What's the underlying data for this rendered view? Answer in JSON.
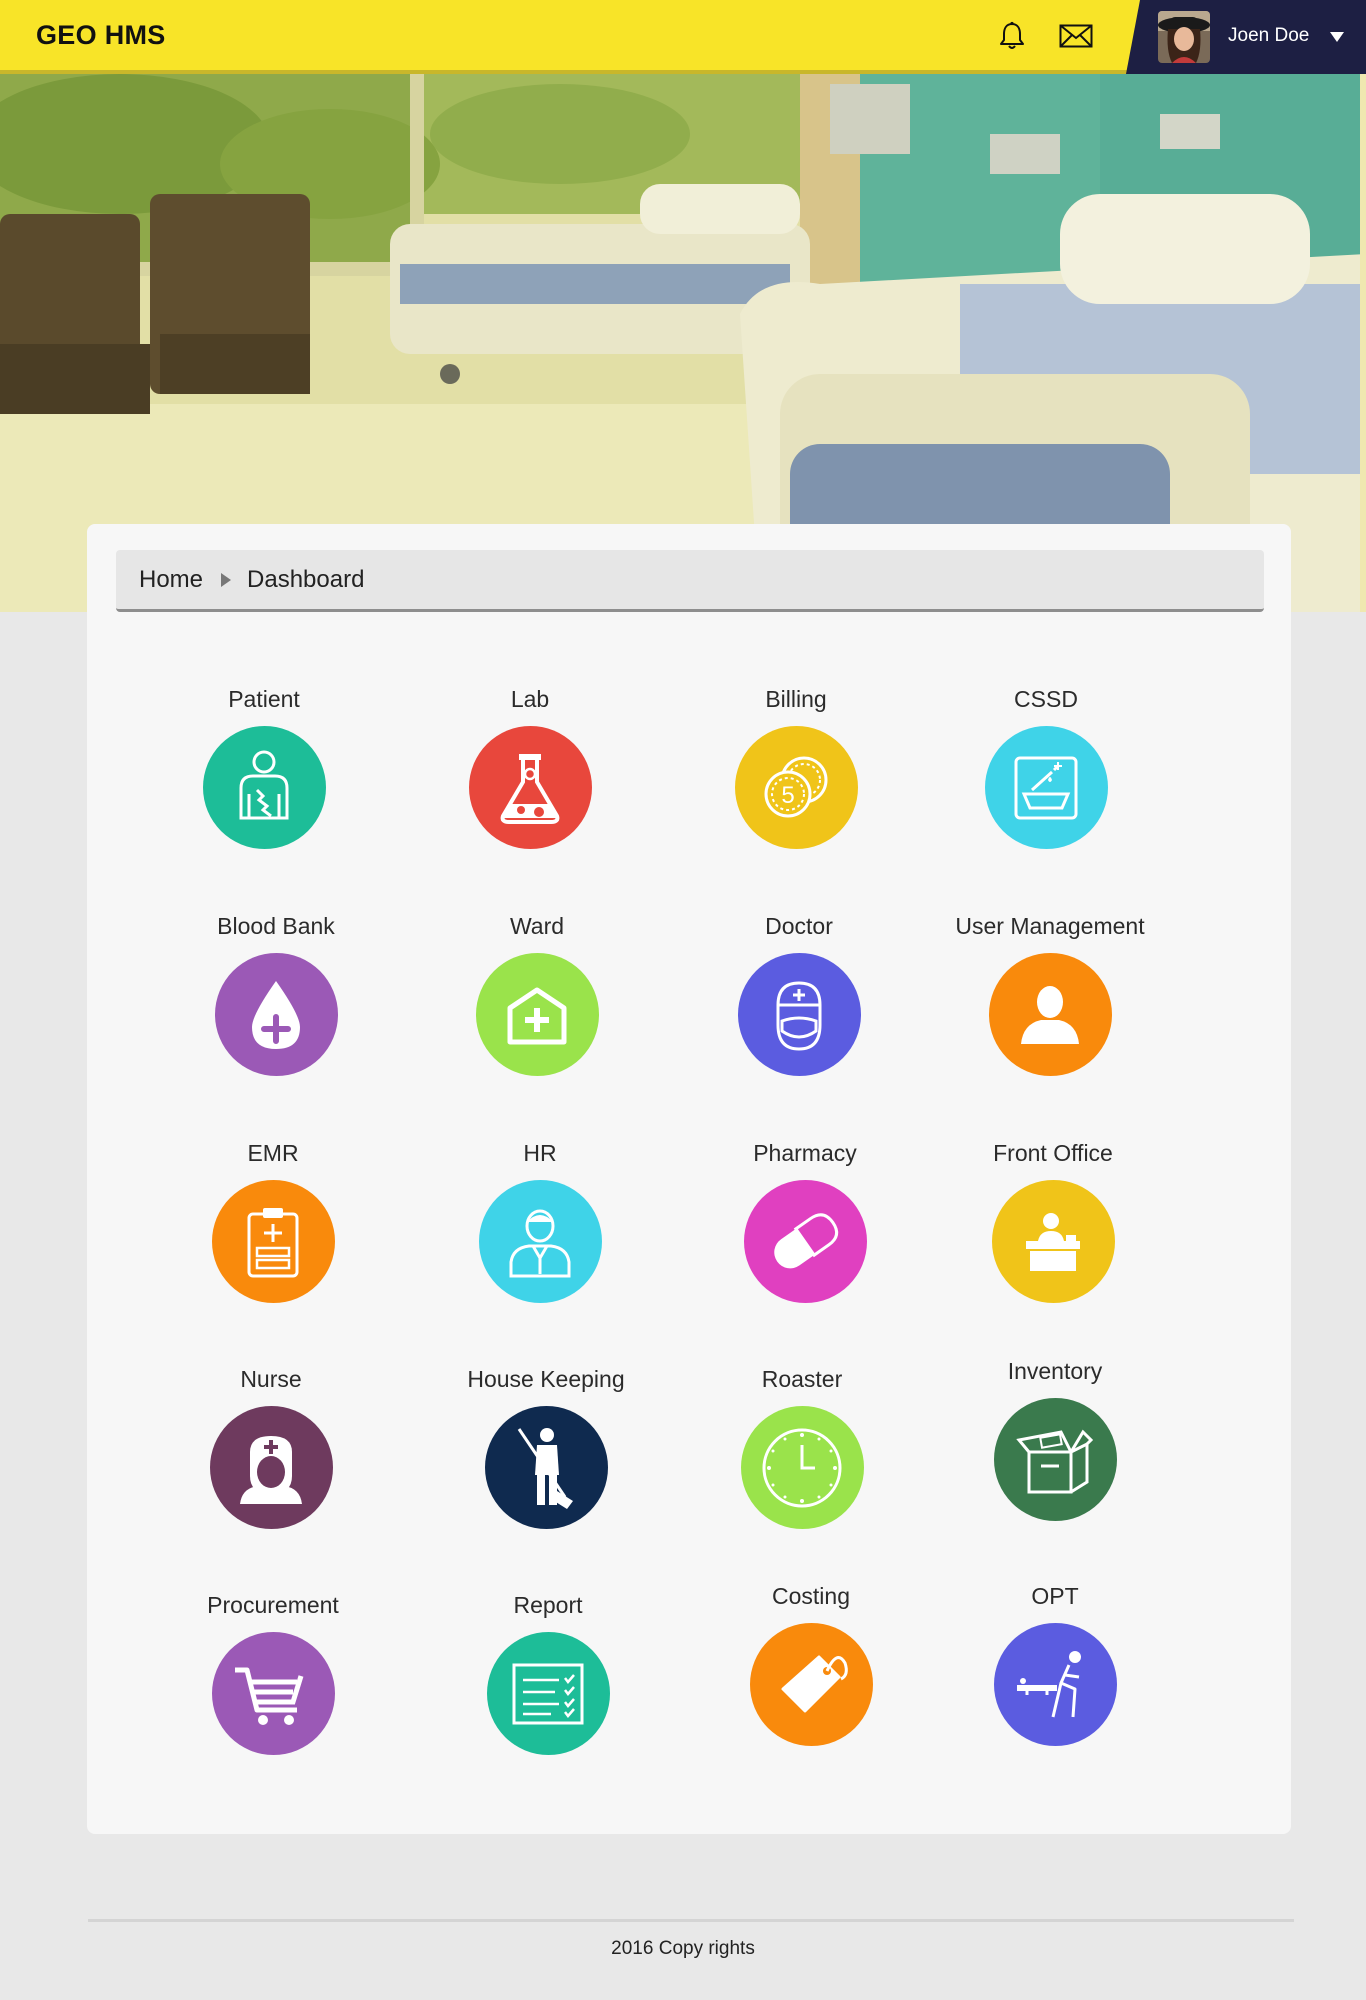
{
  "app": {
    "title": "GEO HMS"
  },
  "header": {
    "notifications_icon": "bell-icon",
    "messages_icon": "envelope-icon",
    "user": {
      "name": "Joen Doe"
    }
  },
  "breadcrumb": {
    "home": "Home",
    "current": "Dashboard"
  },
  "colors": {
    "header_bg": "#f8e428",
    "user_panel_bg": "#1d1f43",
    "page_bg": "#e8e8e8",
    "card_bg": "#f7f7f7"
  },
  "modules": [
    {
      "label": "Patient",
      "color": "#1dbd98",
      "icon": "patient-icon"
    },
    {
      "label": "Lab",
      "color": "#e8473c",
      "icon": "flask-icon"
    },
    {
      "label": "Billing",
      "color": "#f0c419",
      "icon": "coins-icon"
    },
    {
      "label": "CSSD",
      "color": "#3fd3e8",
      "icon": "sterilization-tray-icon"
    },
    {
      "label": "Blood Bank",
      "color": "#9b59b6",
      "icon": "blood-drop-icon"
    },
    {
      "label": "Ward",
      "color": "#9ae34b",
      "icon": "ward-house-icon"
    },
    {
      "label": "Doctor",
      "color": "#5b5ce0",
      "icon": "doctor-icon"
    },
    {
      "label": "User Management",
      "color": "#f98a0c",
      "icon": "user-icon"
    },
    {
      "label": "EMR",
      "color": "#f98a0c",
      "icon": "medical-record-icon"
    },
    {
      "label": "HR",
      "color": "#3fd3e8",
      "icon": "employee-icon"
    },
    {
      "label": "Pharmacy",
      "color": "#e040c0",
      "icon": "pill-icon"
    },
    {
      "label": "Front Office",
      "color": "#f0c419",
      "icon": "reception-desk-icon"
    },
    {
      "label": "Nurse",
      "color": "#6e3a5e",
      "icon": "nurse-icon"
    },
    {
      "label": "House Keeping",
      "color": "#0f2a4f",
      "icon": "janitor-icon"
    },
    {
      "label": "Roaster",
      "color": "#9ae34b",
      "icon": "clock-icon"
    },
    {
      "label": "Inventory",
      "color": "#3a7a4d",
      "icon": "box-icon"
    },
    {
      "label": "Procurement",
      "color": "#9b59b6",
      "icon": "cart-icon"
    },
    {
      "label": "Report",
      "color": "#1dbd98",
      "icon": "report-checklist-icon"
    },
    {
      "label": "Costing",
      "color": "#f98a0c",
      "icon": "price-tag-icon"
    },
    {
      "label": "OPT",
      "color": "#5b5ce0",
      "icon": "operation-theatre-icon"
    }
  ],
  "footer": {
    "text": "2016 Copy rights"
  }
}
